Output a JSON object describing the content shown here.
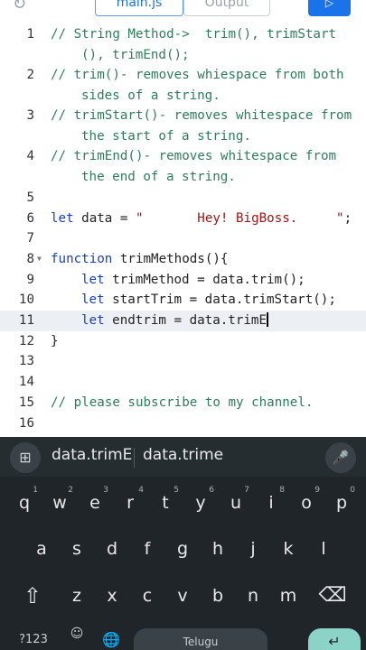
{
  "toolbar": {
    "tab_main": "main.js",
    "tab_output": "Output",
    "run_symbol": "▷",
    "refresh_symbol": "↻"
  },
  "editor": {
    "lines": [
      {
        "n": "1",
        "text": "// String Method->  trim(), trimStart",
        "wrap": "(), trimEnd();"
      },
      {
        "n": "2",
        "text": "// trim()- removes whiespace from both",
        "wrap": "sides of a string."
      },
      {
        "n": "3",
        "text": "// trimStart()- removes whitespace from",
        "wrap": "the start of a string."
      },
      {
        "n": "4",
        "text": "// trimEnd()- removes whitespace from",
        "wrap": "the end of a string."
      },
      {
        "n": "5"
      },
      {
        "n": "6",
        "kw": "let",
        "rest": " data = ",
        "str": "\"       Hey! BigBoss.     \"",
        "tail": ";"
      },
      {
        "n": "7"
      },
      {
        "n": "8",
        "kw": "function",
        "rest": " trimMethods(){"
      },
      {
        "n": "9",
        "kw": "let",
        "rest": " trimMethod = data.trim();"
      },
      {
        "n": "10",
        "kw": "let",
        "rest": " startTrim = data.trimStart();"
      },
      {
        "n": "11",
        "kw": "let",
        "rest": " endtrim = data.trimE"
      },
      {
        "n": "12",
        "rest": "}"
      },
      {
        "n": "13"
      },
      {
        "n": "14"
      },
      {
        "n": "15",
        "text": "// please subscribe to my channel."
      },
      {
        "n": "16"
      }
    ]
  },
  "keyboard": {
    "grid_icon": "⊞",
    "suggestions": [
      "data.trimE",
      "data.trime"
    ],
    "mic_icon": "🎤",
    "row1": [
      [
        "q",
        "1"
      ],
      [
        "w",
        "2"
      ],
      [
        "e",
        "3"
      ],
      [
        "r",
        "4"
      ],
      [
        "t",
        "5"
      ],
      [
        "y",
        "6"
      ],
      [
        "u",
        "7"
      ],
      [
        "i",
        "8"
      ],
      [
        "o",
        "9"
      ],
      [
        "p",
        "0"
      ]
    ],
    "row2": [
      "a",
      "s",
      "d",
      "f",
      "g",
      "h",
      "j",
      "k",
      "l"
    ],
    "row3": [
      "z",
      "x",
      "c",
      "v",
      "b",
      "n",
      "m"
    ],
    "shift": "⇧",
    "backspace": "⌫",
    "symbols": "?123",
    "emoji": "☺",
    "globe": "🌐",
    "space": "Telugu",
    "enter": "↵"
  }
}
